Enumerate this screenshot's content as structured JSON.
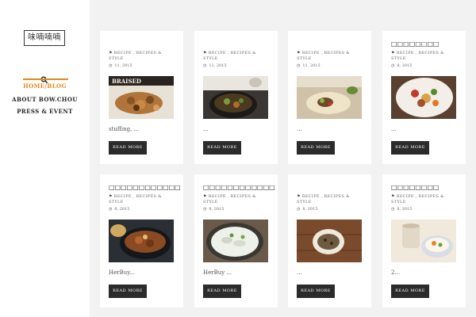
{
  "sidebar": {
    "logo_text": "味喃喃喃",
    "nav": {
      "home": "HOME/BLOG",
      "about": "ABOUT BOW.CHOU",
      "press": "PRESS & EVENT"
    }
  },
  "posts": [
    {
      "title": "",
      "category": "RECIPE , RECIPES & STYLE",
      "date": "11, 2015",
      "excerpt": "stuffing,  ...",
      "read_more": "READ MORE",
      "image": "braised-dish"
    },
    {
      "title": "",
      "category": "RECIPE , RECIPES & STYLE",
      "date": "11, 2015",
      "excerpt": "...",
      "read_more": "READ MORE",
      "image": "dark-pot-dish"
    },
    {
      "title": "",
      "category": "RECIPE , RECIPES & STYLE",
      "date": "11, 2015",
      "excerpt": "...",
      "read_more": "READ MORE",
      "image": "flatbread-dish"
    },
    {
      "title": "□□□□□□□□",
      "category": "RECIPE , RECIPES & STYLE",
      "date": "8, 2015",
      "excerpt": "...",
      "read_more": "READ MORE",
      "image": "stirfry-dish"
    },
    {
      "title": "□□□□□□□□□□□□□□□□□□",
      "category": "RECIPE , RECIPES & STYLE",
      "date": "8, 2015",
      "excerpt": "HerBuy...",
      "read_more": "READ MORE",
      "image": "bowl-dish"
    },
    {
      "title": "□□□□□□□□□□□□□□□□",
      "category": "RECIPE , RECIPES & STYLE",
      "date": "8, 2015",
      "excerpt": "HerBuy ...",
      "read_more": "READ MORE",
      "image": "plate-dish"
    },
    {
      "title": "",
      "category": "RECIPE , RECIPES & STYLE",
      "date": "8, 2015",
      "excerpt": "...",
      "read_more": "READ MORE",
      "image": "anchovy-dish"
    },
    {
      "title": "□□□□□□□□",
      "category": "RECIPE , RECIPES & STYLE",
      "date": "8, 2015",
      "excerpt": "2...",
      "read_more": "READ MORE",
      "image": "cups-dish"
    }
  ]
}
